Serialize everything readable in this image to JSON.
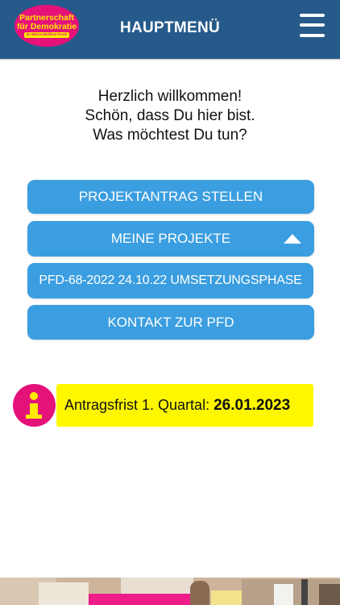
{
  "header": {
    "logo": {
      "line1": "Partnerschaft",
      "line2": "für Demokratie",
      "line3": "im Werra-Meißner-Kreis"
    },
    "title": "HAUPTMENÜ",
    "menu_icon": "hamburger-icon"
  },
  "welcome": {
    "line1": "Herzlich willkommen!",
    "line2": "Schön, dass Du hier bist.",
    "line3": "Was möchtest Du tun?"
  },
  "menu": {
    "projektantrag_label": "PROJEKTANTRAG STELLEN",
    "meine_projekte_label": "MEINE PROJEKTE",
    "meine_projekte_expanded_icon": "caret-up-icon",
    "projects": [
      {
        "label": "PFD-68-2022 24.10.22 UMSETZUNGSPHASE"
      }
    ],
    "kontakt_label": "KONTAKT ZUR PFD"
  },
  "notice": {
    "icon": "info-icon",
    "label": "Antragsfrist 1. Quartal:",
    "date": "26.01.2023"
  },
  "colors": {
    "header_bg": "#265a8a",
    "button_bg": "#3b9ee0",
    "brand_pink": "#e5127a",
    "brand_yellow": "#ffe900",
    "notice_bg": "#fff700"
  }
}
